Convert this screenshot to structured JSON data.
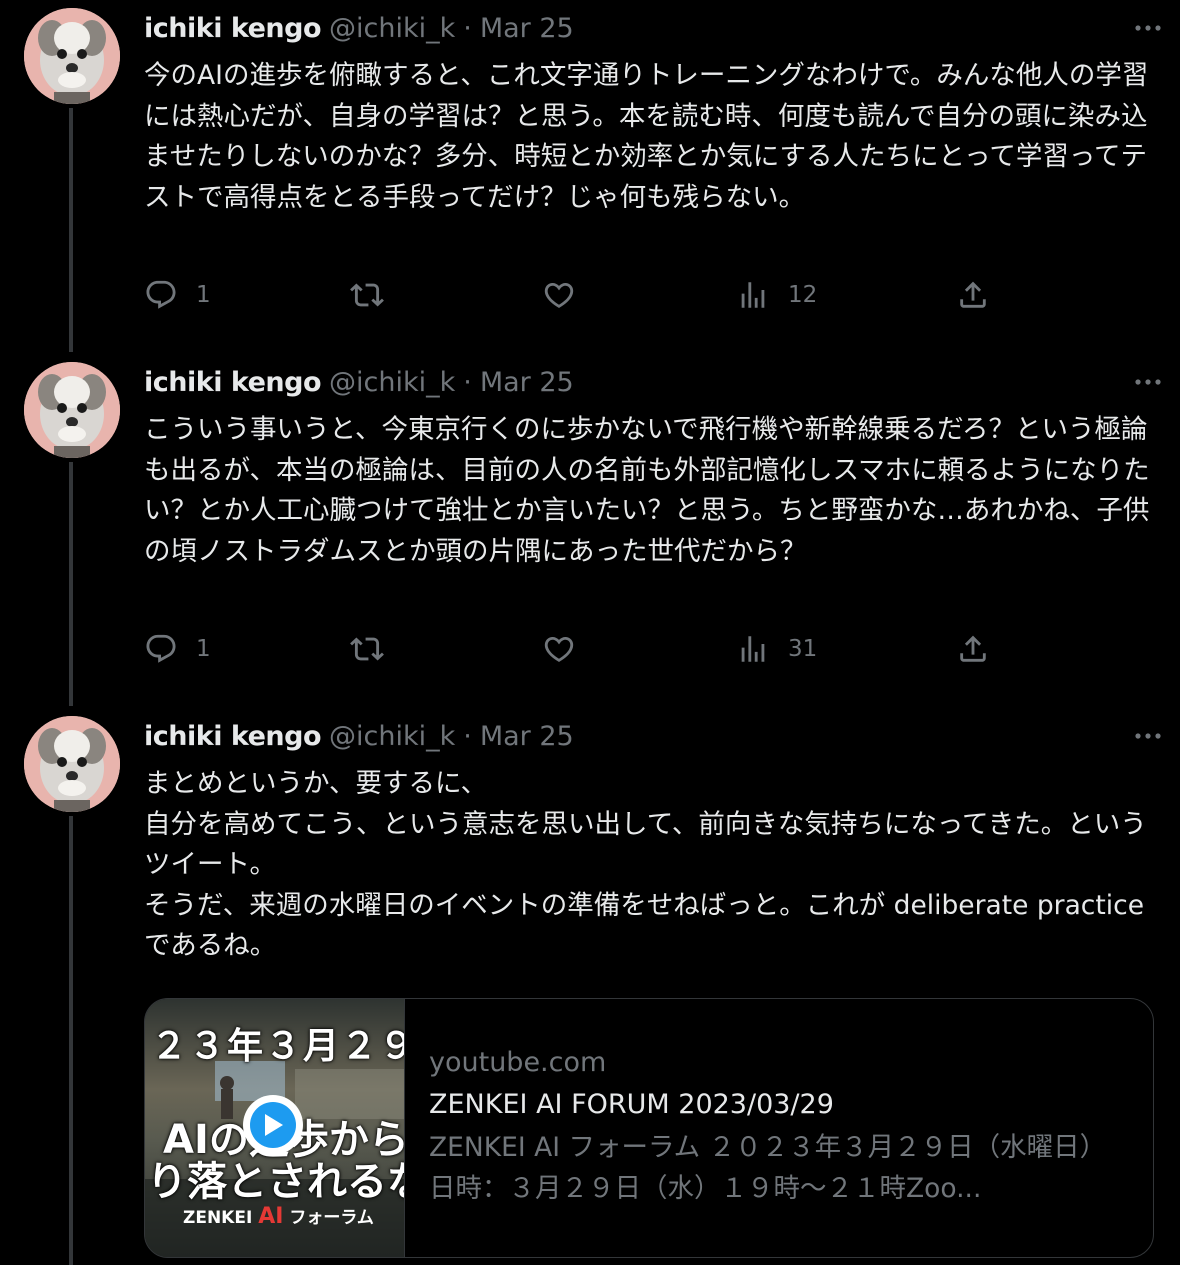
{
  "tweets": [
    {
      "author_name": "ichiki kengo",
      "handle": "@ichiki_k",
      "separator": "·",
      "date": "Mar 25",
      "text": "今のAIの進歩を俯瞰すると、これ文字通りトレーニングなわけで。みんな他人の学習には熱心だが、自身の学習は？と思う。本を読む時、何度も読んで自分の頭に染み込ませたりしないのかな？多分、時短とか効率とか気にする人たちにとって学習ってテストで高得点をとる手段ってだけ？じゃ何も残らない。",
      "reply_count": "1",
      "views_count": "12"
    },
    {
      "author_name": "ichiki kengo",
      "handle": "@ichiki_k",
      "separator": "·",
      "date": "Mar 25",
      "text": "こういう事いうと、今東京行くのに歩かないで飛行機や新幹線乗るだろ？という極論も出るが、本当の極論は、目前の人の名前も外部記憶化しスマホに頼るようになりたい？とか人工心臓つけて強壮とか言いたい？と思う。ちと野蛮かな…あれかね、子供の頃ノストラダムスとか頭の片隅にあった世代だから？",
      "reply_count": "1",
      "views_count": "31"
    },
    {
      "author_name": "ichiki kengo",
      "handle": "@ichiki_k",
      "separator": "·",
      "date": "Mar 25",
      "text": "まとめというか、要するに、\n自分を高めてこう、という意志を思い出して、前向きな気持ちになってきた。というツイート。\nそうだ、来週の水曜日のイベントの準備をせねばっと。これが deliberate practice であるね。",
      "card": {
        "domain": "youtube.com",
        "title": "ZENKEI AI FORUM 2023/03/29",
        "description": "ZENKEI AI フォーラム ２０２３年３月２９日（水曜日）日時：３月２９日（水）１９時〜２１時Zoo...",
        "thumb_top_text": "２３年３月２９",
        "thumb_line1": "AIの進歩から",
        "thumb_line2": "り落とされるな",
        "thumb_brand": "ZENKEI",
        "thumb_brand_ai": "AI",
        "thumb_brand_suffix": "フォーラム"
      }
    }
  ],
  "colors": {
    "background": "#000000",
    "text_primary": "#e7e9ea",
    "text_secondary": "#71767b",
    "border": "#333639",
    "play_button": "#1d9bf0"
  },
  "icons": [
    "reply-icon",
    "retweet-icon",
    "like-icon",
    "views-icon",
    "share-icon",
    "more-icon",
    "play-icon"
  ]
}
